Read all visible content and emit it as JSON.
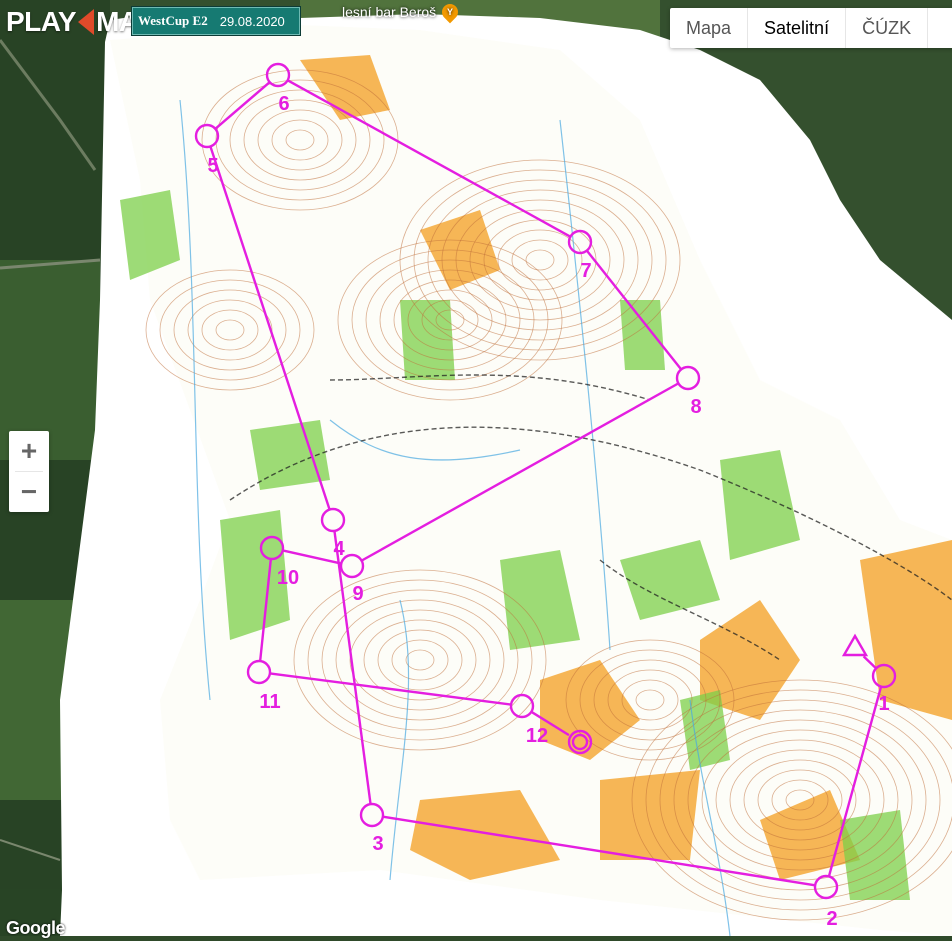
{
  "header": {
    "logo_text": "PLAY",
    "logo_text_2": "MAP",
    "event_name": "WestCup E2",
    "event_date": "29.08.2020",
    "poi_label": "lesní bar Beroš"
  },
  "map_type": {
    "options": [
      "Mapa",
      "Satelitní",
      "ČÚZK",
      ""
    ],
    "selected": "Satelitní"
  },
  "zoom": {
    "in_label": "+",
    "out_label": "−"
  },
  "attribution": "Google",
  "colors": {
    "course": "#e41ee0",
    "satellite_dark": "#2f4a2a",
    "map_paper": "#ffffff",
    "vegetation_green": "#7ccf4a",
    "open_land_orange": "#f4a93a",
    "contour_brown": "#c0703a",
    "water_blue": "#49a8e0"
  },
  "course": {
    "start_label": "start-triangle",
    "controls": [
      {
        "label": "1"
      },
      {
        "label": "2"
      },
      {
        "label": "3"
      },
      {
        "label": "4"
      },
      {
        "label": "5"
      },
      {
        "label": "6"
      },
      {
        "label": "7"
      },
      {
        "label": "8"
      },
      {
        "label": "9"
      },
      {
        "label": "10"
      },
      {
        "label": "11"
      },
      {
        "label": "12"
      }
    ],
    "finish_label": "finish-circles"
  }
}
